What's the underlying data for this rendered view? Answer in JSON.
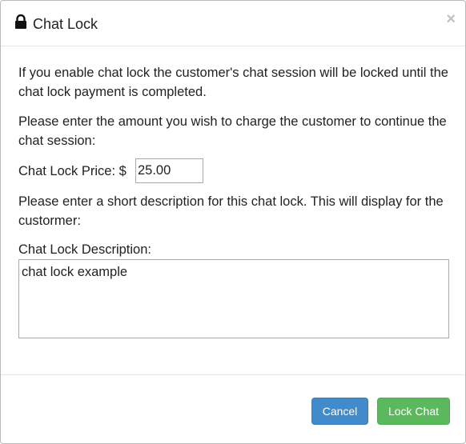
{
  "modal": {
    "title": "Chat Lock",
    "title_icon": "lock-icon",
    "close_label": "×"
  },
  "body": {
    "intro": "If you enable chat lock the customer's chat session will be locked until the chat lock payment is completed.",
    "amount_prompt": "Please enter the amount you wish to charge the customer to continue the chat session:",
    "price_label": "Chat Lock Price: $",
    "price_value": "25.00",
    "description_prompt": "Please enter a short description for this chat lock. This will display for the custormer:",
    "description_label": "Chat Lock Description:",
    "description_value": "chat lock example"
  },
  "footer": {
    "cancel_label": "Cancel",
    "lock_label": "Lock Chat"
  },
  "colors": {
    "cancel_button": "#428bca",
    "lock_button": "#5cb85c"
  }
}
